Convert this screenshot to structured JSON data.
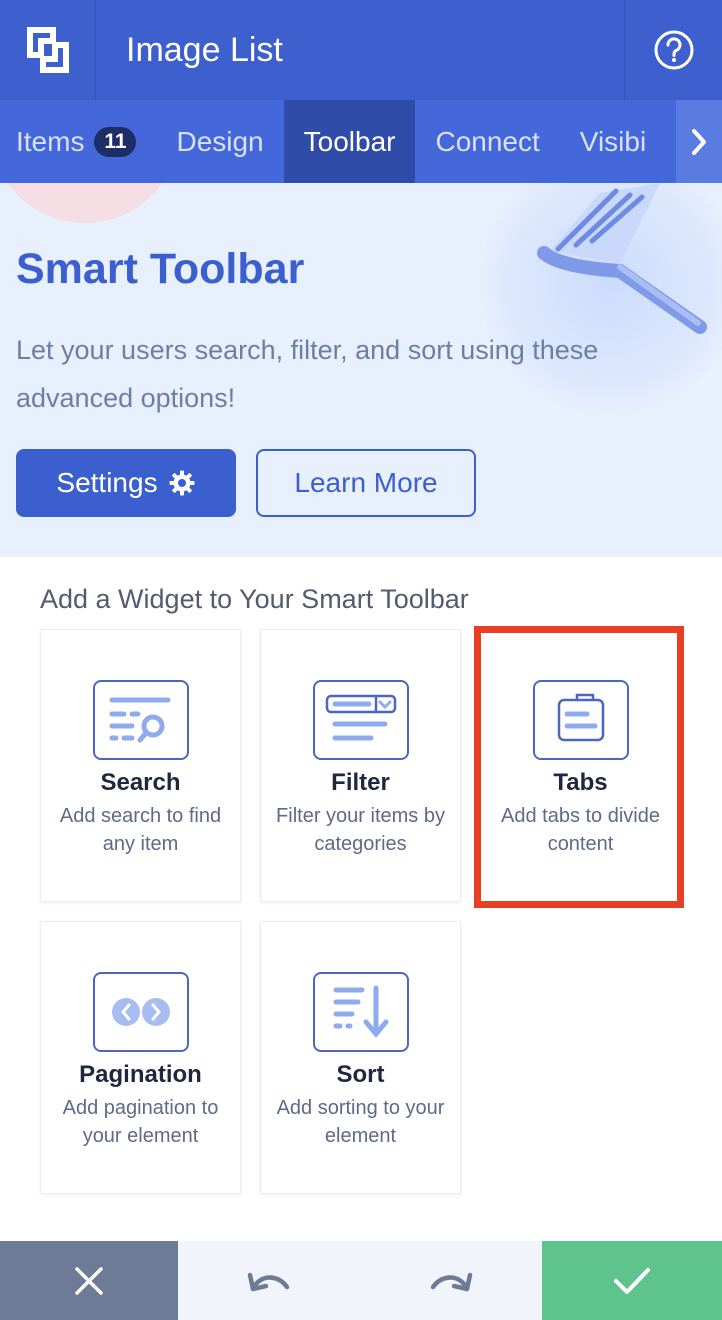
{
  "header": {
    "title": "Image List",
    "logo_icon": "logo-icon",
    "help_icon": "question-icon"
  },
  "tabs": [
    {
      "label": "Items",
      "badge": "11"
    },
    {
      "label": "Design"
    },
    {
      "label": "Toolbar",
      "active": true
    },
    {
      "label": "Connect"
    },
    {
      "label": "Visibi"
    }
  ],
  "tabs_arrow_icon": "chevron-right-icon",
  "hero": {
    "title": "Smart Toolbar",
    "text": "Let your users search, filter, and sort using these advanced options!",
    "settings_label": "Settings",
    "learn_more_label": "Learn More",
    "illustration_icon": "funnel-icon"
  },
  "widgets": {
    "section_title": "Add a Widget to Your Smart Toolbar",
    "items": [
      {
        "name": "Search",
        "desc": "Add search to find any item",
        "icon": "search-widget-icon"
      },
      {
        "name": "Filter",
        "desc": "Filter your items by categories",
        "icon": "filter-widget-icon"
      },
      {
        "name": "Tabs",
        "desc": "Add tabs to divide content",
        "icon": "tabs-widget-icon",
        "highlighted": true
      },
      {
        "name": "Pagination",
        "desc": "Add pagination to your element",
        "icon": "pagination-widget-icon"
      },
      {
        "name": "Sort",
        "desc": "Add sorting to your element",
        "icon": "sort-widget-icon"
      }
    ]
  },
  "footer": {
    "close_icon": "close-icon",
    "undo_icon": "undo-icon",
    "redo_icon": "redo-icon",
    "confirm_icon": "check-icon"
  },
  "colors": {
    "primary": "#3b5fce",
    "header_bg": "#3e5fce",
    "highlight": "#e83e24",
    "confirm": "#5fc48c",
    "close": "#6e7b96"
  }
}
